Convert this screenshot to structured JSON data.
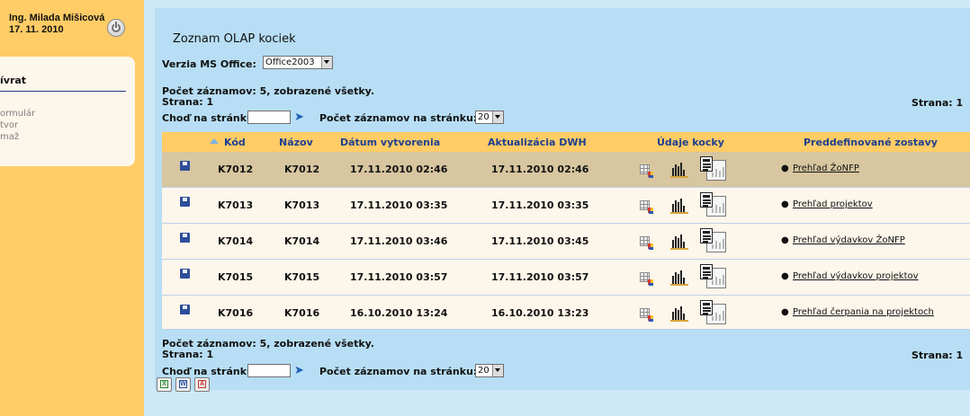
{
  "user": {
    "name": "Ing. Milada Mišicová",
    "date": "17. 11. 2010"
  },
  "sidebar": {
    "title": "ívrat",
    "items": [
      {
        "label": "ormulár"
      },
      {
        "label": "tvor"
      },
      {
        "label": "maž"
      }
    ]
  },
  "page": {
    "title": "Zoznam OLAP kociek",
    "version_label": "Verzia MS Office:",
    "version_value": "Office2003",
    "records_info": "Počet záznamov: 5, zobrazené všetky.",
    "page_label": "Strana: 1",
    "goto_label": "Choď na stránku:",
    "per_page_label": "Počet záznamov na stránku:",
    "per_page_value": "20"
  },
  "table": {
    "headers": {
      "code": "Kód",
      "name": "Názov",
      "created": "Dátum vytvorenia",
      "updated": "Aktualizácia DWH",
      "cube_data": "Údaje kocky",
      "reports": "Preddefinované zostavy"
    },
    "rows": [
      {
        "code": "K7012",
        "name": "K7012",
        "created": "17.11.2010 02:46",
        "updated": "17.11.2010 02:46",
        "report": "Prehľad ŽoNFP",
        "highlighted": true
      },
      {
        "code": "K7013",
        "name": "K7013",
        "created": "17.11.2010 03:35",
        "updated": "17.11.2010 03:35",
        "report": "Prehľad projektov",
        "highlighted": false
      },
      {
        "code": "K7014",
        "name": "K7014",
        "created": "17.11.2010 03:46",
        "updated": "17.11.2010 03:45",
        "report": "Prehľad výdavkov ŽoNFP",
        "highlighted": false
      },
      {
        "code": "K7015",
        "name": "K7015",
        "created": "17.11.2010 03:57",
        "updated": "17.11.2010 03:57",
        "report": "Prehľad výdavkov projektov",
        "highlighted": false
      },
      {
        "code": "K7016",
        "name": "K7016",
        "created": "16.10.2010 13:24",
        "updated": "16.10.2010 13:23",
        "report": "Prehľad čerpania na projektoch",
        "highlighted": false
      }
    ]
  },
  "colors": {
    "sidebar_bg": "#ffcc66",
    "main_bg": "#cde9f7",
    "header_bg": "#ffcc66",
    "row_highlight": "#d7c6a0",
    "row_normal": "#fdf6ea",
    "header_text": "#1e3f8f"
  },
  "icons": {
    "save": "save-icon",
    "cube": "olap-cube-icon",
    "chart": "bar-chart-icon",
    "report": "report-icon",
    "export": [
      "excel-icon",
      "word-icon",
      "pdf-icon"
    ]
  }
}
